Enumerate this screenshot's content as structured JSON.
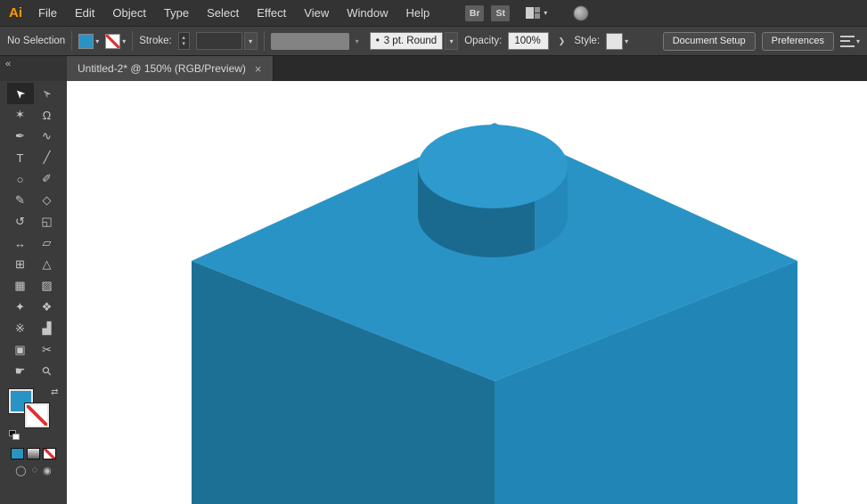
{
  "app": {
    "logo": "Ai"
  },
  "menu": {
    "items": [
      "File",
      "Edit",
      "Object",
      "Type",
      "Select",
      "Effect",
      "View",
      "Window",
      "Help"
    ]
  },
  "menu_extras": {
    "bridge": "Br",
    "stock": "St"
  },
  "control_bar": {
    "selection_status": "No Selection",
    "stroke_label": "Stroke:",
    "brush_bullet": "•",
    "brush_name": "3 pt. Round",
    "opacity_label": "Opacity:",
    "opacity_value": "100%",
    "style_label": "Style:",
    "document_setup": "Document Setup",
    "preferences": "Preferences"
  },
  "tab": {
    "title": "Untitled-2* @ 150% (RGB/Preview)"
  },
  "icons": {
    "chevron_down": "▾",
    "chevron_right": "❯",
    "stepper_up": "▴",
    "stepper_down": "▾",
    "swap": "⇄",
    "collapse": "«",
    "close": "×",
    "draw_mode_1": "◯",
    "draw_mode_2": "◌",
    "draw_mode_3": "◉"
  },
  "tools": [
    {
      "name": "selection",
      "glyph": "➤"
    },
    {
      "name": "direct-selection",
      "glyph": "➢"
    },
    {
      "name": "magic-wand",
      "glyph": "✶"
    },
    {
      "name": "lasso",
      "glyph": "Ω"
    },
    {
      "name": "pen",
      "glyph": "✒"
    },
    {
      "name": "curvature",
      "glyph": "∿"
    },
    {
      "name": "type",
      "glyph": "T"
    },
    {
      "name": "line-segment",
      "glyph": "╱"
    },
    {
      "name": "ellipse",
      "glyph": "○"
    },
    {
      "name": "paintbrush",
      "glyph": "✐"
    },
    {
      "name": "pencil",
      "glyph": "✎"
    },
    {
      "name": "eraser",
      "glyph": "◇"
    },
    {
      "name": "rotate",
      "glyph": "↺"
    },
    {
      "name": "scale",
      "glyph": "◱"
    },
    {
      "name": "width",
      "glyph": "↔"
    },
    {
      "name": "free-transform",
      "glyph": "▱"
    },
    {
      "name": "shape-builder",
      "glyph": "⊞"
    },
    {
      "name": "perspective-grid",
      "glyph": "△"
    },
    {
      "name": "mesh",
      "glyph": "▦"
    },
    {
      "name": "gradient",
      "glyph": "▨"
    },
    {
      "name": "eyedropper",
      "glyph": "✦"
    },
    {
      "name": "blend",
      "glyph": "❖"
    },
    {
      "name": "symbol-sprayer",
      "glyph": "※"
    },
    {
      "name": "column-graph",
      "glyph": "▟"
    },
    {
      "name": "artboard",
      "glyph": "▣"
    },
    {
      "name": "slice",
      "glyph": "✂"
    },
    {
      "name": "hand",
      "glyph": "☛"
    },
    {
      "name": "zoom",
      "glyph": "⚲"
    }
  ],
  "colors": {
    "logo_orange": "#ff9a00",
    "fill_swatch": "#2a93c6",
    "stroke_none_red": "#e03131"
  },
  "canvas": {
    "background": "#ffffff",
    "brick": {
      "top_face": "#2a93c6",
      "left_face": "#1d7095",
      "right_face": "#2186b6",
      "stud_top": "#2e9ace",
      "stud_side": "#1a6a90",
      "stud_side_highlight": "#2489ba"
    }
  }
}
